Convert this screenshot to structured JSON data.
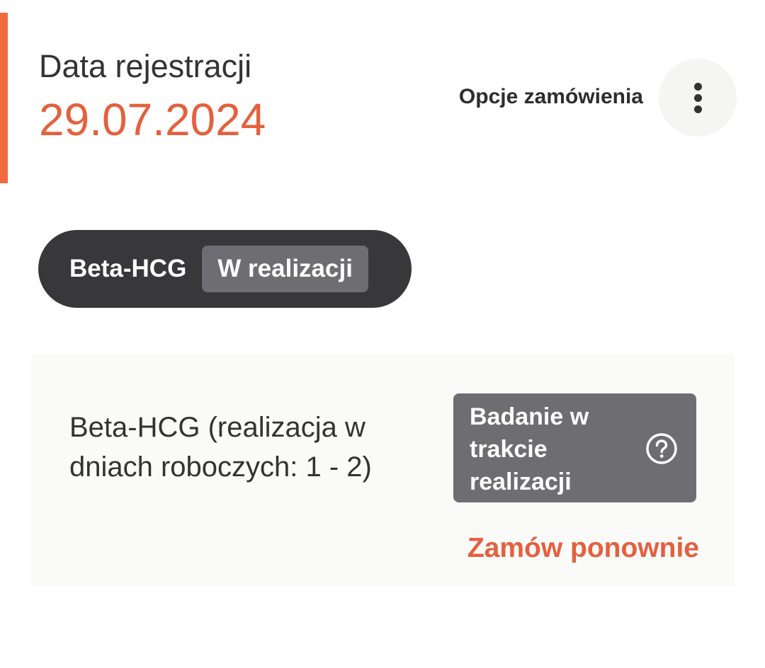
{
  "header": {
    "registration_label": "Data rejestracji",
    "registration_date": "29.07.2024",
    "options_label": "Opcje zamówienia",
    "menu_icon": "more-vertical-icon"
  },
  "order_pill": {
    "test_name": "Beta-HCG",
    "status": "W realizacji"
  },
  "test_card": {
    "description": "Beta-HCG (realizacja w dniach roboczych: 1 - 2)",
    "status_text": "Badanie w trakcie realizacji",
    "help_icon": "help-circle-icon",
    "reorder_label": "Zamów ponownie"
  },
  "colors": {
    "accent": "#e4603e",
    "accent_bar": "#f26a3d",
    "pill_background": "#38383a",
    "status_background": "#6e6d72",
    "card_background": "#fafaf9"
  }
}
